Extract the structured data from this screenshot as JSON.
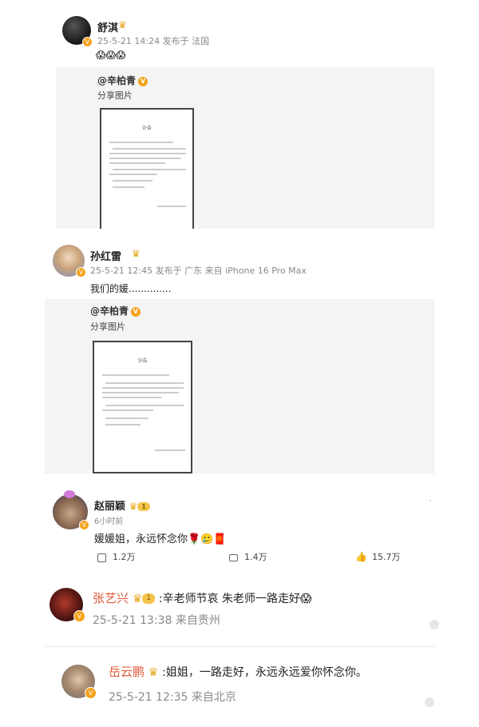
{
  "post1": {
    "name": "舒淇",
    "meta": "25-5-21 14:24 发布于 法国",
    "emoji": "😱😱😱"
  },
  "share1": {
    "mention": "@辛柏青",
    "label": "分享图片",
    "doc_title": "讣告"
  },
  "post2": {
    "name": "孙红雷",
    "meta": "25-5-21 12:45 发布于 广东 来自 iPhone 16 Pro Max",
    "text": "我们的媛.............."
  },
  "share2": {
    "mention": "@辛柏青",
    "label": "分享图片",
    "doc_title": "讣告"
  },
  "post3": {
    "name": "赵丽颖",
    "level": "1",
    "time": "6小时前",
    "text": "媛媛姐，永远怀念你🌹🥲🧧",
    "actions": {
      "repost": "1.2万",
      "comment": "1.4万",
      "like": "15.7万"
    }
  },
  "comment1": {
    "name": "张艺兴",
    "level": "1",
    "text": ":辛老师节哀 朱老师一路走好😱",
    "meta": "25-5-21 13:38 来自贵州"
  },
  "comment2": {
    "name": "岳云鹏",
    "text": ":姐姐，一路走好，永远永远爱你怀念你。",
    "meta": "25-5-21 12:35 来自北京"
  },
  "colors": {
    "accent_orange": "#f4a21c",
    "comment_name_red": "#e25a3a",
    "meta_gray": "#8a8a8a"
  }
}
